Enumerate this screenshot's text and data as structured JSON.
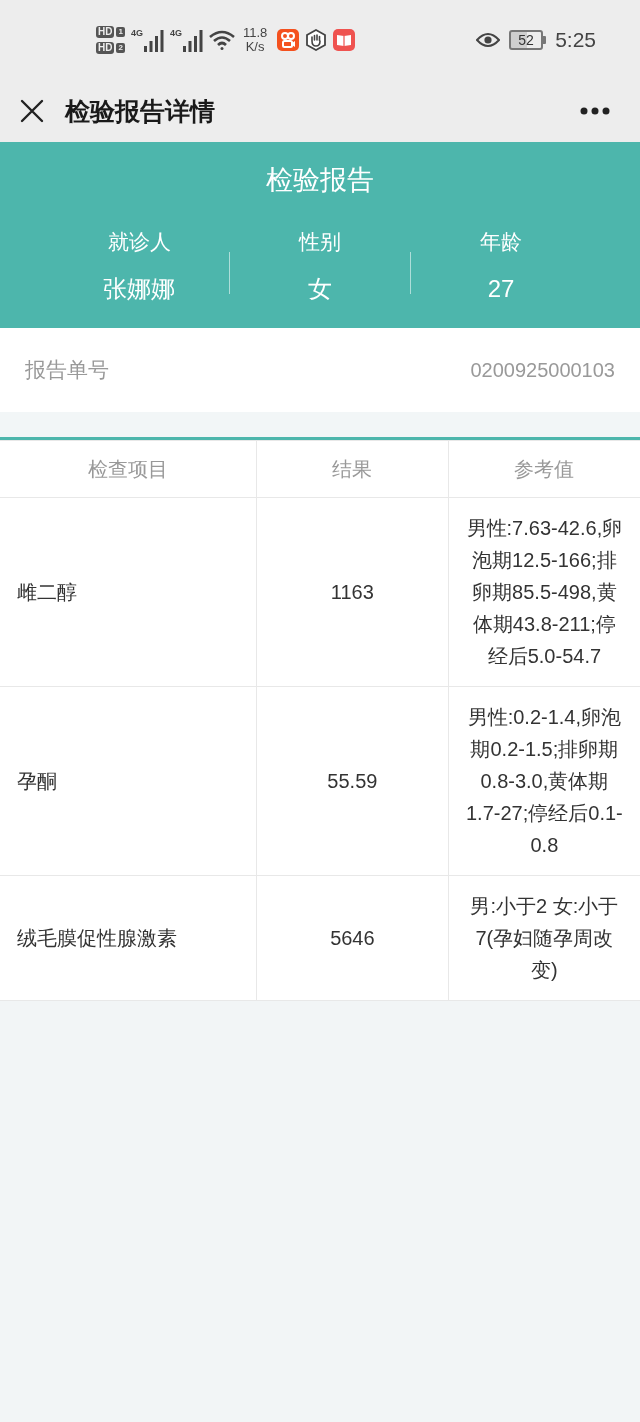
{
  "status_bar": {
    "sim_badges": [
      {
        "label": "HD",
        "slot": "1"
      },
      {
        "label": "HD",
        "slot": "2"
      }
    ],
    "signals": [
      {
        "label": "4G"
      },
      {
        "label": "4G"
      }
    ],
    "network_speed": {
      "value": "11.8",
      "unit": "K/s"
    },
    "battery": "52",
    "time": "5:25"
  },
  "title_bar": {
    "title": "检验报告详情"
  },
  "header": {
    "title": "检验报告",
    "fields": [
      {
        "label": "就诊人",
        "value": "张娜娜"
      },
      {
        "label": "性别",
        "value": "女"
      },
      {
        "label": "年龄",
        "value": "27"
      }
    ]
  },
  "report_number": {
    "label": "报告单号",
    "value": "0200925000103"
  },
  "table": {
    "columns": [
      "检查项目",
      "结果",
      "参考值"
    ],
    "rows": [
      {
        "item": "雌二醇",
        "result": "1163",
        "reference": "男性:7.63-42.6,卵泡期12.5-166;排卵期85.5-498,黄体期43.8-211;停经后5.0-54.7"
      },
      {
        "item": "孕酮",
        "result": "55.59",
        "reference": "男性:0.2-1.4,卵泡期0.2-1.5;排卵期0.8-3.0,黄体期1.7-27;停经后0.1-0.8"
      },
      {
        "item": "绒毛膜促性腺激素",
        "result": "5646",
        "reference": "男:小于2 女:小于7(孕妇随孕周改变)"
      }
    ]
  }
}
